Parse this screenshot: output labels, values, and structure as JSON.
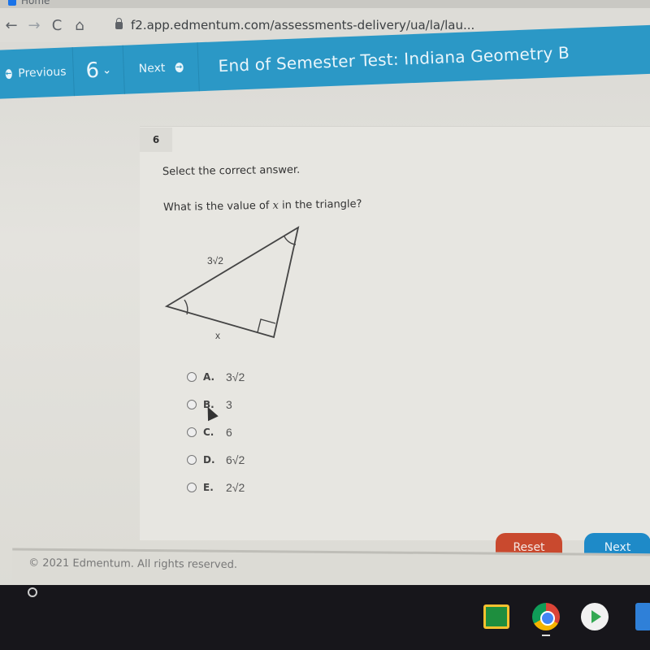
{
  "browser": {
    "tab_label": "Home",
    "url": "f2.app.edmentum.com/assessments-delivery/ua/la/lau...",
    "nav": {
      "back": "←",
      "forward": "→",
      "reload": "C",
      "home": "⌂"
    }
  },
  "appbar": {
    "previous_label": "Previous",
    "question_number": "6",
    "next_label": "Next",
    "title": "End of Semester Test: Indiana Geometry B",
    "accent_color": "#2b98c6"
  },
  "question": {
    "number": "6",
    "instruction": "Select the correct answer.",
    "prompt_before": "What is the value of ",
    "prompt_var": "x",
    "prompt_after": " in the triangle?",
    "figure": {
      "hypotenuse_label": "3√2",
      "base_label": "x",
      "marks": [
        "congruent-angle-left",
        "congruent-angle-top",
        "right-angle"
      ]
    },
    "choices": [
      {
        "letter": "A.",
        "value": "3√2"
      },
      {
        "letter": "B.",
        "value": "3"
      },
      {
        "letter": "C.",
        "value": "6"
      },
      {
        "letter": "D.",
        "value": "6√2"
      },
      {
        "letter": "E.",
        "value": "2√2"
      }
    ]
  },
  "actions": {
    "reset_label": "Reset",
    "next_label": "Next",
    "reset_color": "#c9492e",
    "next_color": "#1e8ac8"
  },
  "footer": {
    "copyright": "© 2021 Edmentum. All rights reserved."
  },
  "shelf": {
    "apps": [
      "Google Classroom",
      "Chrome",
      "Play Store",
      "Files"
    ]
  }
}
